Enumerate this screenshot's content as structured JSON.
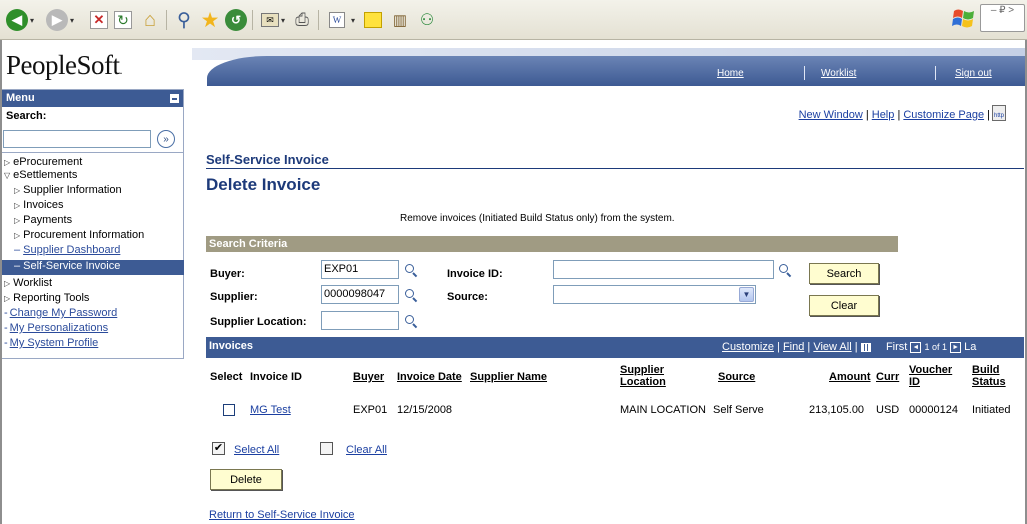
{
  "browser": {
    "window_controls": "– ₽ >",
    "buttons": [
      "back",
      "forward",
      "stop",
      "refresh",
      "home",
      "search",
      "favorites",
      "history",
      "mail",
      "print",
      "edit",
      "notes",
      "research",
      "messenger"
    ]
  },
  "app": {
    "logo": "PeopleSoft",
    "logo_mark": ".",
    "nav": {
      "home": "Home",
      "worklist": "Worklist",
      "signout": "Sign out"
    }
  },
  "menu": {
    "title": "Menu",
    "search_label": "Search:",
    "search_value": "",
    "go_glyph": "»",
    "items": [
      {
        "label": "eProcurement",
        "arrow": "▷"
      },
      {
        "label": "eSettlements",
        "arrow": "▽"
      },
      {
        "label": "Supplier Information",
        "arrow": "▷"
      },
      {
        "label": "Invoices",
        "arrow": "▷"
      },
      {
        "label": "Payments",
        "arrow": "▷"
      },
      {
        "label": "Procurement Information",
        "arrow": "▷"
      },
      {
        "label": "Supplier Dashboard",
        "prefix": "–"
      },
      {
        "label": "Self-Service Invoice",
        "prefix": "–"
      },
      {
        "label": "Worklist",
        "arrow": "▷"
      },
      {
        "label": "Reporting Tools",
        "arrow": "▷"
      },
      {
        "label": "Change My Password",
        "prefix": "-"
      },
      {
        "label": "My Personalizations",
        "prefix": "-"
      },
      {
        "label": "My System Profile",
        "prefix": "-"
      }
    ]
  },
  "toplinks": {
    "new_window": "New Window",
    "sep": "|",
    "help": "Help",
    "customize": "Customize Page",
    "http": "http"
  },
  "page": {
    "section_title": "Self-Service Invoice",
    "title": "Delete Invoice",
    "instructions": "Remove invoices (Initiated Build Status only) from the system."
  },
  "criteria": {
    "header": "Search Criteria",
    "buyer_label": "Buyer:",
    "buyer_value": "EXP01",
    "supplier_label": "Supplier:",
    "supplier_value": "0000098047",
    "supplier_location_label": "Supplier Location:",
    "supplier_location_value": "",
    "invoice_id_label": "Invoice ID:",
    "invoice_id_value": "",
    "source_label": "Source:",
    "source_value": "",
    "search_button": "Search",
    "clear_button": "Clear"
  },
  "grid": {
    "title": "Invoices",
    "customize": "Customize",
    "find": "Find",
    "view_all": "View All",
    "first": "First",
    "prev_glyph": "◄",
    "next_glyph": "►",
    "page_text": "1 of 1",
    "last": "La",
    "columns": {
      "select": "Select",
      "invoice_id": "Invoice ID",
      "buyer": "Buyer",
      "invoice_date": "Invoice Date",
      "supplier_name": "Supplier Name",
      "supplier_location_1": "Supplier",
      "supplier_location_2": "Location",
      "source": "Source",
      "amount": "Amount",
      "curr": "Curr",
      "voucher_1": "Voucher",
      "voucher_2": "ID",
      "build_1": "Build",
      "build_2": "Status"
    },
    "rows": [
      {
        "invoice_id": "MG Test",
        "buyer": "EXP01",
        "invoice_date": "12/15/2008",
        "supplier_name": "",
        "supplier_location": "MAIN LOCATION",
        "source": "Self Serve",
        "amount": "213,105.00",
        "curr": "USD",
        "voucher_id": "00000124",
        "build_status": "Initiated"
      }
    ]
  },
  "actions": {
    "select_all": "Select All",
    "clear_all": "Clear All",
    "delete_button": "Delete",
    "return_link": "Return to Self-Service Invoice"
  }
}
